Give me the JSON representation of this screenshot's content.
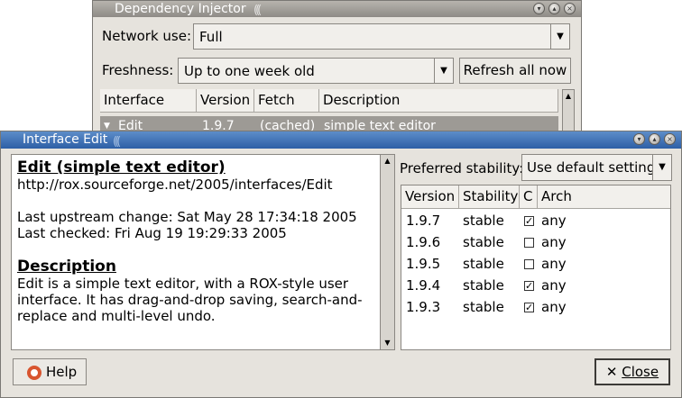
{
  "dep_window": {
    "title": "Dependency Injector",
    "network_label": "Network use:",
    "network_value": "Full",
    "freshness_label": "Freshness:",
    "freshness_value": "Up to one week old",
    "refresh_button": "Refresh all now",
    "columns": [
      "Interface",
      "Version",
      "Fetch",
      "Description"
    ],
    "row": {
      "interface": "Edit",
      "version": "1.9.7",
      "fetch": "(cached)",
      "description": "simple text editor"
    }
  },
  "edit_window": {
    "title": "Interface Edit",
    "doc": {
      "heading": "Edit (simple text editor)",
      "url": "http://rox.sourceforge.net/2005/interfaces/Edit",
      "last_upstream": "Last upstream change: Sat May 28 17:34:18 2005",
      "last_checked": "Last checked: Fri Aug 19 19:29:33 2005",
      "desc_heading": "Description",
      "desc_lines": [
        "Edit is a simple text editor, with a ROX-style user",
        "interface. It has drag-and-drop saving, search-and-",
        "replace and multi-level undo."
      ]
    },
    "stability_label": "Preferred stability:",
    "stability_value": "Use default setting",
    "columns": [
      "Version",
      "Stability",
      "C",
      "Arch"
    ],
    "versions": [
      {
        "version": "1.9.7",
        "stability": "stable",
        "checked": true,
        "arch": "any"
      },
      {
        "version": "1.9.6",
        "stability": "stable",
        "checked": false,
        "arch": "any"
      },
      {
        "version": "1.9.5",
        "stability": "stable",
        "checked": false,
        "arch": "any"
      },
      {
        "version": "1.9.4",
        "stability": "stable",
        "checked": true,
        "arch": "any"
      },
      {
        "version": "1.9.3",
        "stability": "stable",
        "checked": true,
        "arch": "any"
      }
    ],
    "help_button": "Help",
    "close_button": "Close"
  }
}
